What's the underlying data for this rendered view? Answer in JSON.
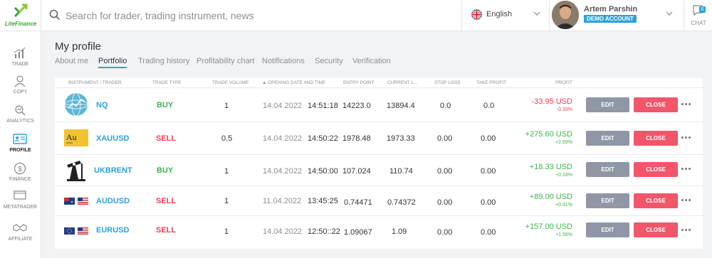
{
  "brand": {
    "logo_text": "LiteFinance"
  },
  "search": {
    "placeholder": "Search for trader, trading instrument, news"
  },
  "language": {
    "label": "English"
  },
  "user": {
    "name": "Artem Parshin",
    "account_badge": "DEMO ACCOUNT"
  },
  "chat": {
    "label": "CHAT",
    "badge": "6"
  },
  "sidebar": {
    "items": [
      {
        "label": "TRADE",
        "icon": "chart-bars-icon"
      },
      {
        "label": "COPY",
        "icon": "people-icon"
      },
      {
        "label": "ANALYTICS",
        "icon": "analytics-icon"
      },
      {
        "label": "PROFILE",
        "icon": "id-card-icon",
        "active": true
      },
      {
        "label": "FINANCE",
        "icon": "dollar-circle-icon"
      },
      {
        "label": "METATRADER",
        "icon": "monitor-icon"
      },
      {
        "label": "AFFILIATE",
        "icon": "handshake-icon"
      }
    ]
  },
  "page": {
    "title": "My profile"
  },
  "tabs": [
    {
      "label": "About me"
    },
    {
      "label": "Portfolio",
      "active": true
    },
    {
      "label": "Trading history"
    },
    {
      "label": "Profitability chart"
    },
    {
      "label": "Notifications"
    },
    {
      "label": "Security"
    },
    {
      "label": "Verification"
    }
  ],
  "table": {
    "headers": {
      "instrument": "INSTRUMENT / TRADER",
      "type": "TRADE TYPE",
      "volume": "TRADE VOLUME",
      "opening": "▲  OPENING DATE AND TIME",
      "entry": "ENTRY POINT",
      "current": "CURRENT L...",
      "stop": "STOP LOSS",
      "take": "TAKE PROFIT",
      "profit": "PROFIT"
    },
    "edit_label": "EDIT",
    "close_label": "CLOSE",
    "rows": [
      {
        "symbol": "NQ",
        "icon": "nasdaq-globe-icon",
        "type": "BUY",
        "volume": "1",
        "date": "14.04.2022",
        "time": "14:51:18",
        "entry": "14223.0",
        "current": "13894.4",
        "stop": "0.0",
        "take": "0.0",
        "profit": "-33.95 USD",
        "percent": "-0.33%",
        "sign": "neg"
      },
      {
        "symbol": "XAUUSD",
        "icon": "gold-icon",
        "icon_text": "Au",
        "type": "SELL",
        "volume": "0.5",
        "date": "14.04.2022",
        "time": "14:50:22",
        "entry": "1978.48",
        "current": "1973.33",
        "stop": "0.00",
        "take": "0.00",
        "profit": "+275.60 USD",
        "percent": "+2.69%",
        "sign": "pos"
      },
      {
        "symbol": "UKBRENT",
        "icon": "oil-pump-icon",
        "type": "BUY",
        "volume": "1",
        "date": "14.04.2022",
        "time": "14:50:00",
        "entry": "107.024",
        "current": "110.74",
        "stop": "0.00",
        "take": "0.00",
        "profit": "+18.33 USD",
        "percent": "+0.18%",
        "sign": "pos"
      },
      {
        "symbol": "AUDUSD",
        "icon": "aud-usd-flags-icon",
        "type": "SELL",
        "volume": "1",
        "date": "11.04.2022",
        "time": "13:45:25",
        "entry": "0.74471",
        "current": "0.74372",
        "stop": "0.00",
        "take": "0.00",
        "profit": "+89.00 USD",
        "percent": "+0.91%",
        "sign": "pos"
      },
      {
        "symbol": "EURUSD",
        "icon": "eur-usd-flags-icon",
        "type": "SELL",
        "volume": "1",
        "date": "14.04.2022",
        "time": "12:50::22",
        "entry": "1.09067",
        "current": "1.09",
        "stop": "0.00",
        "take": "0.00",
        "profit": "+157.00 USD",
        "percent": "+1.56%",
        "sign": "pos"
      }
    ]
  },
  "colors": {
    "accent": "#2aa3d8",
    "buy": "#3ab54a",
    "sell": "#ee3e54",
    "close_btn": "#f1566a",
    "edit_btn": "#8f97a6"
  }
}
